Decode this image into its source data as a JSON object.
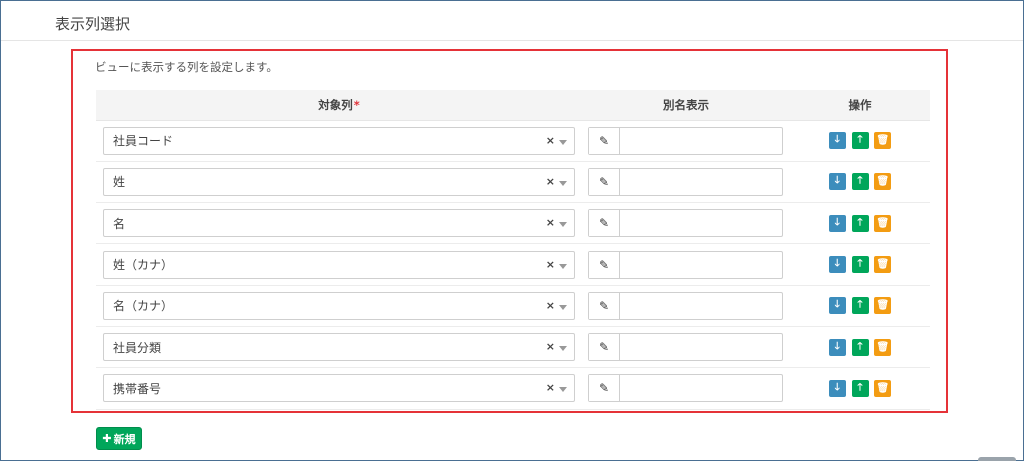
{
  "header": {
    "title": "表示列選択"
  },
  "description": "ビューに表示する列を設定します。",
  "table": {
    "headers": {
      "target": "対象列",
      "required_mark": "*",
      "alias": "別名表示",
      "ops": "操作"
    },
    "rows": [
      {
        "target": "社員コード",
        "alias": ""
      },
      {
        "target": "姓",
        "alias": ""
      },
      {
        "target": "名",
        "alias": ""
      },
      {
        "target": "姓（カナ）",
        "alias": ""
      },
      {
        "target": "名（カナ）",
        "alias": ""
      },
      {
        "target": "社員分類",
        "alias": ""
      },
      {
        "target": "携帯番号",
        "alias": ""
      }
    ]
  },
  "icons": {
    "clear": "×",
    "pencil": "✎",
    "down": "🡓",
    "up": "🡑",
    "trash": "🗑"
  },
  "new_button": {
    "label": "新規",
    "icon": "plus-icon"
  },
  "colors": {
    "highlight": "#e53238",
    "move_down": "#3c8dbc",
    "move_up": "#00a65a",
    "delete": "#f39c12",
    "new": "#00a65a"
  }
}
